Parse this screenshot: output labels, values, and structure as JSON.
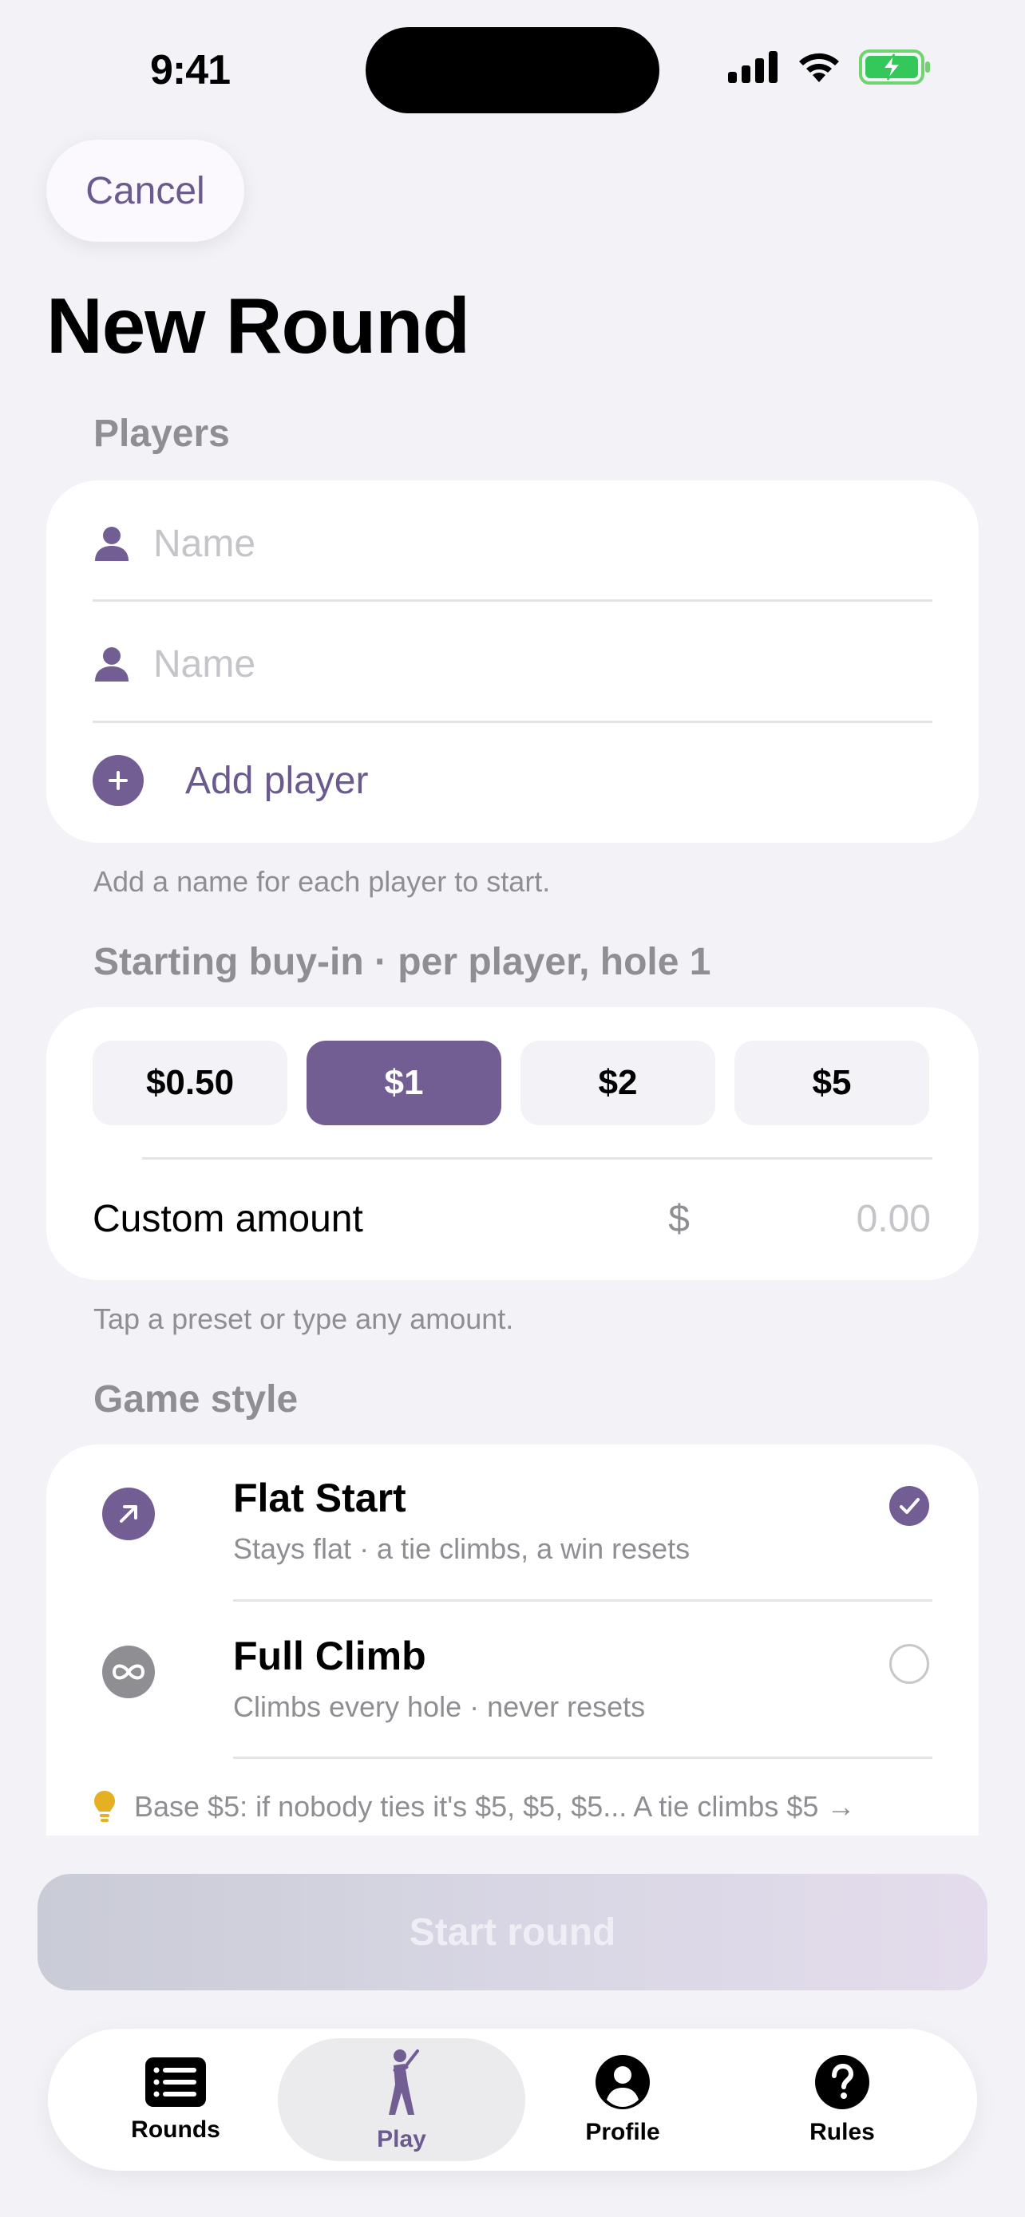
{
  "status_bar": {
    "time": "9:41"
  },
  "header": {
    "cancel_label": "Cancel",
    "title": "New Round"
  },
  "players": {
    "header": "Players",
    "fields": [
      {
        "placeholder": "Name",
        "value": ""
      },
      {
        "placeholder": "Name",
        "value": ""
      }
    ],
    "add_label": "Add player",
    "footnote": "Add a name for each player to start."
  },
  "buyin": {
    "header": "Starting buy-in · per player, hole 1",
    "presets": [
      "$0.50",
      "$1",
      "$2",
      "$5"
    ],
    "selected": "$1",
    "custom_label": "Custom amount",
    "currency_symbol": "$",
    "custom_placeholder": "0.00",
    "footnote": "Tap a preset or type any amount."
  },
  "game_style": {
    "header": "Game style",
    "options": [
      {
        "title": "Flat Start",
        "subtitle": "Stays flat · a tie climbs, a win resets",
        "selected": true,
        "icon": "arrow-up-right-icon"
      },
      {
        "title": "Full Climb",
        "subtitle": "Climbs every hole · never resets",
        "selected": false,
        "icon": "infinity-icon"
      }
    ],
    "hint": "Base $5: if nobody ties it's $5, $5, $5... A tie climbs $5 →"
  },
  "start_button": {
    "label": "Start round",
    "enabled": false
  },
  "tabbar": {
    "tabs": [
      {
        "label": "Rounds",
        "icon": "list-icon"
      },
      {
        "label": "Play",
        "icon": "golfer-icon",
        "active": true
      },
      {
        "label": "Profile",
        "icon": "person-circle-icon"
      },
      {
        "label": "Rules",
        "icon": "question-circle-icon"
      }
    ]
  },
  "colors": {
    "accent": "#735e94",
    "background": "#f2f2f7",
    "secondary_text": "#8e8e93"
  }
}
